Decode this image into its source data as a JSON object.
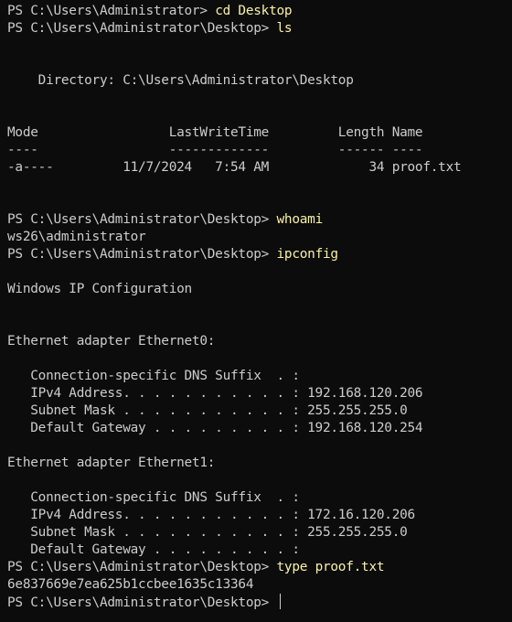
{
  "terminal": {
    "colors": {
      "background": "#0c0c0c",
      "text": "#cccccc",
      "command": "#f9f1a5"
    },
    "lines": [
      {
        "prompt": "PS C:\\Users\\Administrator> ",
        "command": "cd Desktop"
      },
      {
        "prompt": "PS C:\\Users\\Administrator\\Desktop> ",
        "command": "ls"
      },
      {
        "text": ""
      },
      {
        "text": ""
      },
      {
        "text": "    Directory: C:\\Users\\Administrator\\Desktop"
      },
      {
        "text": ""
      },
      {
        "text": ""
      },
      {
        "text": "Mode                 LastWriteTime         Length Name"
      },
      {
        "text": "----                 -------------         ------ ----"
      },
      {
        "text": "-a----         11/7/2024   7:54 AM             34 proof.txt"
      },
      {
        "text": ""
      },
      {
        "text": ""
      },
      {
        "prompt": "PS C:\\Users\\Administrator\\Desktop> ",
        "command": "whoami"
      },
      {
        "text": "ws26\\administrator"
      },
      {
        "prompt": "PS C:\\Users\\Administrator\\Desktop> ",
        "command": "ipconfig"
      },
      {
        "text": ""
      },
      {
        "text": "Windows IP Configuration"
      },
      {
        "text": ""
      },
      {
        "text": ""
      },
      {
        "text": "Ethernet adapter Ethernet0:"
      },
      {
        "text": ""
      },
      {
        "text": "   Connection-specific DNS Suffix  . :"
      },
      {
        "text": "   IPv4 Address. . . . . . . . . . . : 192.168.120.206"
      },
      {
        "text": "   Subnet Mask . . . . . . . . . . . : 255.255.255.0"
      },
      {
        "text": "   Default Gateway . . . . . . . . . : 192.168.120.254"
      },
      {
        "text": ""
      },
      {
        "text": "Ethernet adapter Ethernet1:"
      },
      {
        "text": ""
      },
      {
        "text": "   Connection-specific DNS Suffix  . :"
      },
      {
        "text": "   IPv4 Address. . . . . . . . . . . : 172.16.120.206"
      },
      {
        "text": "   Subnet Mask . . . . . . . . . . . : 255.255.255.0"
      },
      {
        "text": "   Default Gateway . . . . . . . . . :"
      },
      {
        "prompt": "PS C:\\Users\\Administrator\\Desktop> ",
        "command": "type proof.txt"
      },
      {
        "text": "6e837669e7ea625b1ccbee1635c13364"
      },
      {
        "prompt": "PS C:\\Users\\Administrator\\Desktop> ",
        "command": "",
        "cursor": true
      }
    ]
  }
}
